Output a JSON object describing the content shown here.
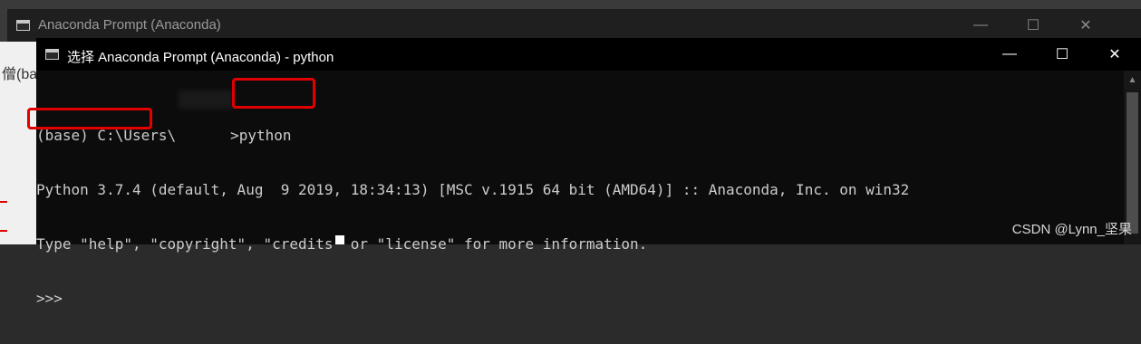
{
  "back_window": {
    "title": "Anaconda Prompt (Anaconda)",
    "side_text": "僧(ba",
    "buttons": {
      "minimize": "—",
      "maximize": "☐",
      "close": "✕"
    }
  },
  "front_window": {
    "title": "选择 Anaconda Prompt (Anaconda) - python",
    "buttons": {
      "minimize": "—",
      "maximize": "☐",
      "close": "✕"
    }
  },
  "console": {
    "prompt_line_prefix": "(base) C:\\Users\\",
    "prompt_line_command": ">python",
    "version_line_version": "Python 3.7.4",
    "version_line_rest": " (default, Aug  9 2019, 18:34:13) [MSC v.1915 64 bit (AMD64)] :: Anaconda, Inc. on win32",
    "info_line": "Type \"help\", \"copyright\", \"credits\" or \"license\" for more information.",
    "repl_prompt": ">>>"
  },
  "watermark": "CSDN @Lynn_坚果",
  "colors": {
    "highlight": "#e00000",
    "console_text": "#cccccc",
    "console_bg": "#0c0c0c"
  }
}
